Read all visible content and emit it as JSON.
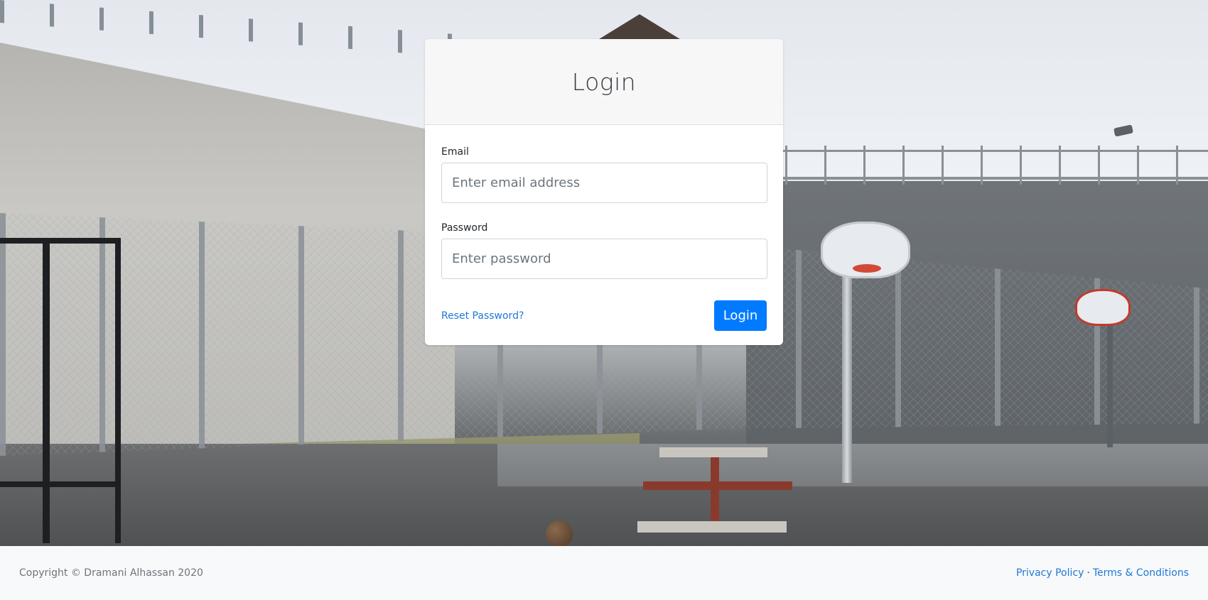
{
  "login_card": {
    "title": "Login",
    "email": {
      "label": "Email",
      "placeholder": "Enter email address",
      "value": ""
    },
    "password": {
      "label": "Password",
      "placeholder": "Enter password",
      "value": ""
    },
    "reset_link": "Reset Password?",
    "submit_label": "Login"
  },
  "footer": {
    "copyright": "Copyright © Dramani Alhassan 2020",
    "links": {
      "privacy": "Privacy Policy",
      "separator": "·",
      "terms": "Terms & Conditions"
    }
  },
  "colors": {
    "accent": "#007bff",
    "link": "#1e78d6",
    "footer_bg": "#f8f9fa"
  }
}
